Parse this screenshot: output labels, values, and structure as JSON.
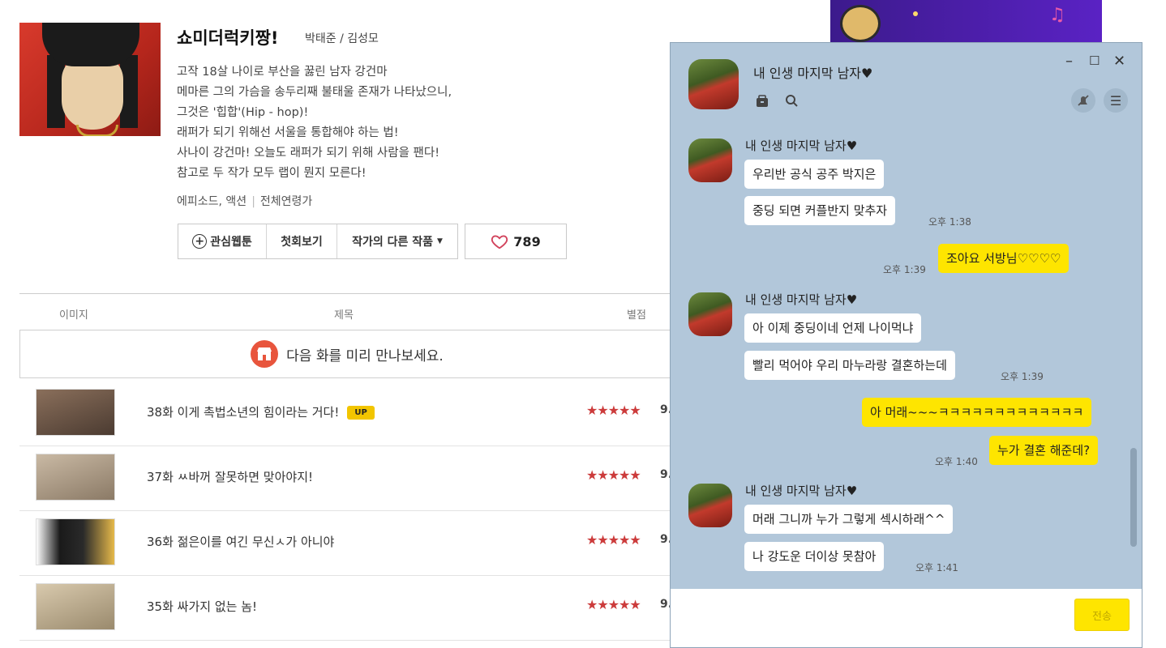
{
  "webtoon": {
    "title": "쇼미더럭키짱!",
    "authors": "박태준 / 김성모",
    "synopsis": [
      "고작 18살 나이로 부산을 꿇린 남자 강건마",
      "메마른 그의 가슴을 송두리째 불태울 존재가 나타났으니,",
      "그것은 '힙합'(Hip - hop)!",
      "래퍼가 되기 위해선 서울을 통합해야 하는 법!",
      "사나이 강건마! 오늘도 래퍼가 되기 위해 사람을 팬다!",
      "참고로 두 작가 모두 랩이 뭔지 모른다!"
    ],
    "genre": "에피소드, 액션",
    "age": "전체연령가",
    "buttons": {
      "interest": "관심웹툰",
      "first": "첫회보기",
      "other_works": "작가의 다른 작품",
      "like_count": "789"
    },
    "columns": {
      "image": "이미지",
      "title": "제목",
      "rating": "별점"
    },
    "preview_text": "다음 화를 미리 만나보세요.",
    "episodes": [
      {
        "title": "38화 이게 촉법소년의 힘이라는 거다!",
        "badge": "UP",
        "stars": "★★★★★",
        "score": "9."
      },
      {
        "title": "37화 ㅆ바꺼 잘못하면 맞아야지!",
        "badge": "",
        "stars": "★★★★★",
        "score": "9."
      },
      {
        "title": "36화 젊은이를 여긴 무신ㅅ가 아니야",
        "badge": "",
        "stars": "★★★★★",
        "score": "9."
      },
      {
        "title": "35화 싸가지 없는 놈!",
        "badge": "",
        "stars": "★★★★★",
        "score": "9."
      }
    ]
  },
  "chat": {
    "room_title": "내 인생 마지막 남자♥",
    "send_label": "전송",
    "messages": {
      "g1_sender": "내 인생 마지막 남자♥",
      "g1_m1": "우리반 공식 공주 박지은",
      "g1_m2": "중딩 되면 커플반지 맞추자",
      "g1_time": "오후 1:38",
      "me1": "조아요 서방님♡♡♡♡",
      "me1_time": "오후 1:39",
      "g2_sender": "내 인생 마지막 남자♥",
      "g2_m1": "아 이제 중딩이네 언제 나이먹냐",
      "g2_m2": "빨리 먹어야 우리 마누라랑 결혼하는데",
      "g2_time": "오후 1:39",
      "me2_m1": "아 머래~~~ㅋㅋㅋㅋㅋㅋㅋㅋㅋㅋㅋㅋㅋ",
      "me2_m2": "누가 결혼 해준데?",
      "me2_time": "오후 1:40",
      "g3_sender": "내 인생 마지막 남자♥",
      "g3_m1": "머래 그니까 누가 그렇게 섹시하래^^",
      "g3_m2": "나 강도운 더이상 못참아",
      "g3_time": "오후 1:41"
    }
  },
  "colors": {
    "chat_bg": "#b2c7da",
    "my_bubble": "#fee500",
    "star": "#cc3b3b",
    "badge": "#f2c500"
  }
}
